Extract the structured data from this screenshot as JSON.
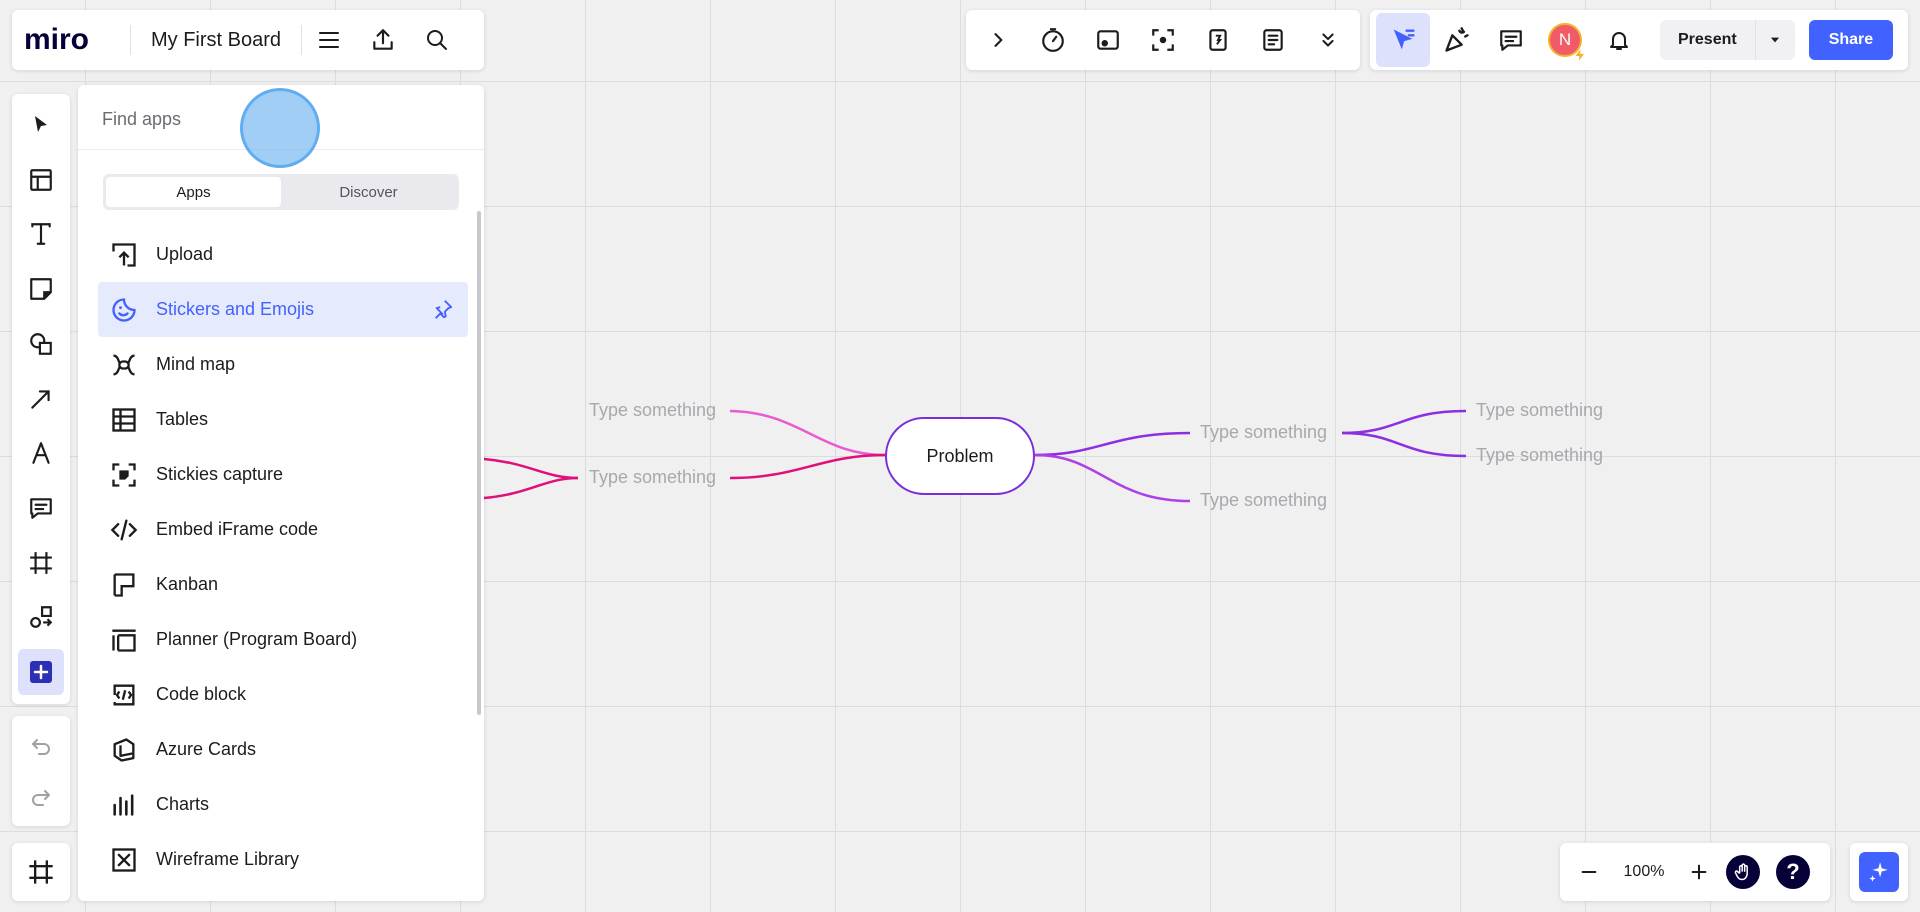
{
  "header": {
    "logo_text": "miro",
    "board_title": "My First Board"
  },
  "apps_panel": {
    "search_placeholder": "Find apps",
    "tabs": [
      {
        "label": "Apps",
        "selected": true
      },
      {
        "label": "Discover",
        "selected": false
      }
    ],
    "items": [
      {
        "label": "Upload",
        "icon": "upload-icon"
      },
      {
        "label": "Stickers and Emojis",
        "icon": "sticker-icon",
        "hovered": true
      },
      {
        "label": "Mind map",
        "icon": "mind-map-icon"
      },
      {
        "label": "Tables",
        "icon": "table-icon"
      },
      {
        "label": "Stickies capture",
        "icon": "stickies-capture-icon"
      },
      {
        "label": "Embed iFrame code",
        "icon": "code-embed-icon"
      },
      {
        "label": "Kanban",
        "icon": "kanban-icon"
      },
      {
        "label": "Planner (Program Board)",
        "icon": "planner-icon"
      },
      {
        "label": "Code block",
        "icon": "code-block-icon"
      },
      {
        "label": "Azure Cards",
        "icon": "azure-cards-icon"
      },
      {
        "label": "Charts",
        "icon": "charts-icon"
      },
      {
        "label": "Wireframe Library",
        "icon": "wireframe-icon"
      }
    ]
  },
  "toolbar_right": {
    "avatar_initial": "N",
    "present_label": "Present",
    "share_label": "Share"
  },
  "mindmap": {
    "center": "Problem",
    "left_nodes": [
      "Type something",
      "Type something"
    ],
    "right_nodes": [
      "Type something",
      "Type something"
    ],
    "right_sub_nodes": [
      "Type something",
      "Type something"
    ]
  },
  "zoom": {
    "level": "100%",
    "help_label": "?"
  },
  "colors": {
    "accent": "#4262ff",
    "mindmap_center_border": "#7a2ed9",
    "branch_pink": "#e8479a",
    "branch_magenta": "#e0107a",
    "branch_violet": "#a33be0"
  }
}
